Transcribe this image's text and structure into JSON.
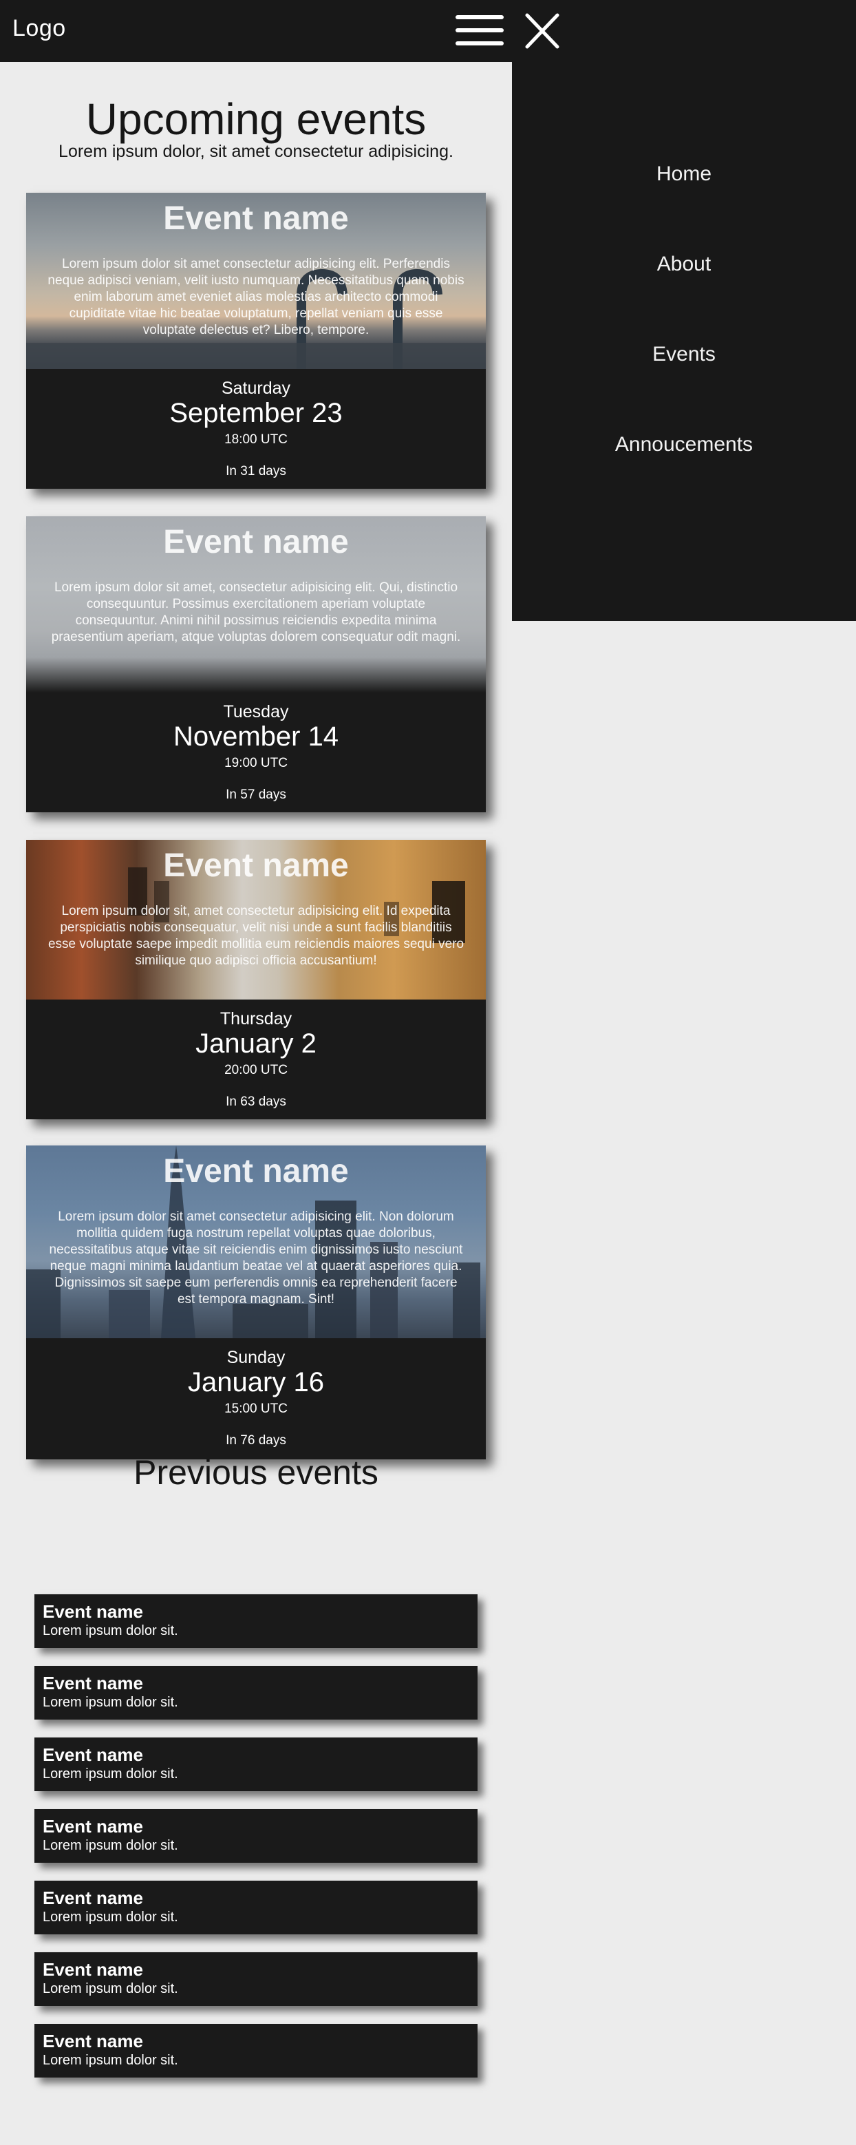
{
  "header": {
    "logo": "Logo"
  },
  "nav": {
    "items": [
      {
        "label": "Home"
      },
      {
        "label": "About"
      },
      {
        "label": "Events"
      },
      {
        "label": "Annoucements"
      }
    ]
  },
  "upcoming": {
    "title": "Upcoming events",
    "subtitle": "Lorem ipsum dolor, sit amet consectetur adipisicing.",
    "events": [
      {
        "name": "Event name",
        "description": "Lorem ipsum dolor sit amet consectetur adipisicing elit. Perferendis neque adipisci veniam, velit iusto numquam. Necessitatibus quam nobis enim laborum amet eveniet alias molestias architecto commodi cupiditate vitae hic beatae voluptatum, repellat veniam quis esse voluptate delectus et? Libero, tempore.",
        "day": "Saturday",
        "date": "September 23",
        "time": "18:00 UTC",
        "countdown": "In 31 days"
      },
      {
        "name": "Event name",
        "description": "Lorem ipsum dolor sit amet, consectetur adipisicing elit. Qui, distinctio consequuntur. Possimus exercitationem aperiam voluptate consequuntur. Animi nihil possimus reiciendis expedita minima praesentium aperiam, atque voluptas dolorem consequatur odit magni.",
        "day": "Tuesday",
        "date": "November 14",
        "time": "19:00 UTC",
        "countdown": "In 57 days"
      },
      {
        "name": "Event name",
        "description": "Lorem ipsum dolor sit, amet consectetur adipisicing elit. Id expedita perspiciatis nobis consequatur, velit nisi unde a sunt facilis blanditiis esse voluptate saepe impedit mollitia eum reiciendis maiores sequi vero similique quo adipisci officia accusantium!",
        "day": "Thursday",
        "date": "January 2",
        "time": "20:00 UTC",
        "countdown": "In 63 days"
      },
      {
        "name": "Event name",
        "description": "Lorem ipsum dolor sit amet consectetur adipisicing elit. Non dolorum mollitia quidem fuga nostrum repellat voluptas quae doloribus, necessitatibus atque vitae sit reiciendis enim dignissimos iusto nesciunt neque magni minima laudantium beatae vel at quaerat asperiores quia. Dignissimos sit saepe eum perferendis omnis ea reprehenderit facere est tempora magnam. Sint!",
        "day": "Sunday",
        "date": "January 16",
        "time": "15:00 UTC",
        "countdown": "In 76 days"
      }
    ]
  },
  "previous": {
    "title": "Previous events",
    "events": [
      {
        "name": "Event name",
        "description": "Lorem ipsum dolor sit."
      },
      {
        "name": "Event name",
        "description": "Lorem ipsum dolor sit."
      },
      {
        "name": "Event name",
        "description": "Lorem ipsum dolor sit."
      },
      {
        "name": "Event name",
        "description": "Lorem ipsum dolor sit."
      },
      {
        "name": "Event name",
        "description": "Lorem ipsum dolor sit."
      },
      {
        "name": "Event name",
        "description": "Lorem ipsum dolor sit."
      },
      {
        "name": "Event name",
        "description": "Lorem ipsum dolor sit."
      }
    ]
  },
  "colors": {
    "dark": "#181818",
    "page_background": "#ececec",
    "text_light": "#ffffff",
    "text_dark": "#161616"
  },
  "icons": {
    "menu": "hamburger-icon",
    "close": "close-icon"
  }
}
